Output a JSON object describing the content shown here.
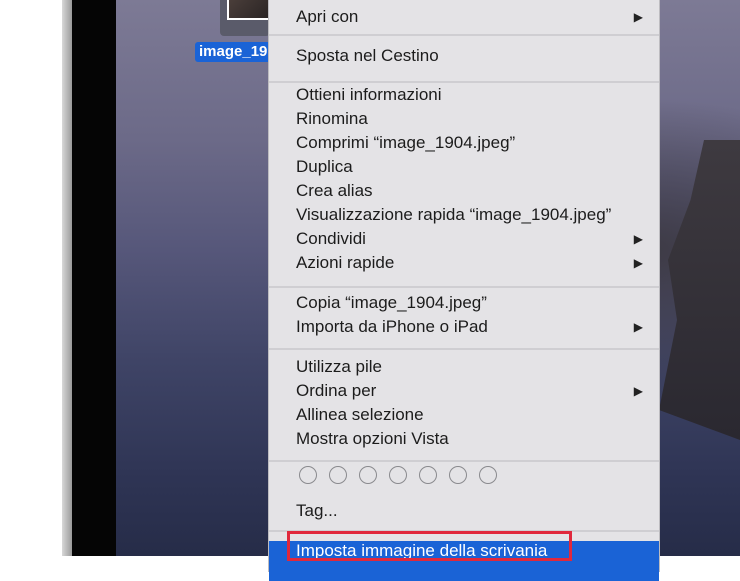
{
  "desktop": {
    "file_label": "image_1904.jpeg",
    "file_label_visible": "image_19"
  },
  "menu": {
    "groups": [
      [
        {
          "label": "Apri con",
          "submenu": true
        }
      ],
      [
        {
          "label": "Sposta nel Cestino"
        }
      ],
      [
        {
          "label": "Ottieni informazioni"
        },
        {
          "label": "Rinomina"
        },
        {
          "label": "Comprimi “image_1904.jpeg”"
        },
        {
          "label": "Duplica"
        },
        {
          "label": "Crea alias"
        },
        {
          "label": "Visualizzazione rapida “image_1904.jpeg”"
        },
        {
          "label": "Condividi",
          "submenu": true
        },
        {
          "label": "Azioni rapide",
          "submenu": true
        }
      ],
      [
        {
          "label": "Copia “image_1904.jpeg”"
        },
        {
          "label": "Importa da iPhone o iPad",
          "submenu": true
        }
      ],
      [
        {
          "label": "Utilizza pile"
        },
        {
          "label": "Ordina per",
          "submenu": true
        },
        {
          "label": "Allinea selezione"
        },
        {
          "label": "Mostra opzioni Vista"
        }
      ]
    ],
    "tags_label": "Tag...",
    "tag_colors_count": 7,
    "highlighted": "Imposta immagine della scrivania",
    "submenu_arrow": "▶",
    "highlight_color": "#1a63d6",
    "annotation_color": "#e0283c"
  }
}
